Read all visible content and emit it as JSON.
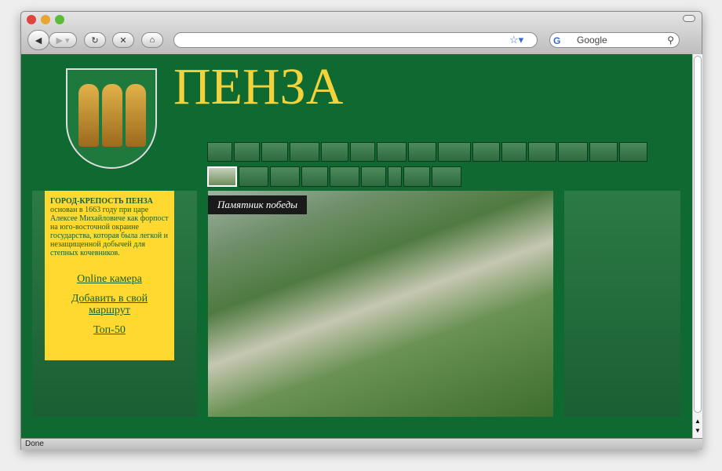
{
  "browser": {
    "url": "",
    "search_placeholder": "Google",
    "status": "Done",
    "icons": [
      "back-icon",
      "forward-icon",
      "reload-icon",
      "stop-icon",
      "home-icon",
      "star-icon",
      "search-icon"
    ]
  },
  "site": {
    "title": "ПЕНЗА",
    "info_heading": "ГОРОД-КРЕПОСТЬ ПЕНЗА",
    "info_text": "основан в 1663 году при царе Алексее Михайловиче как форпост на юго-восточной окраине государства, которая была легкой и незащищенной добычей для степных кочевников.",
    "links": [
      "Online камера",
      "Добавить в свой маршрут",
      "Топ-50"
    ],
    "photo_caption": "Памятник победы",
    "colors": {
      "background": "#0f6a32",
      "accent": "#ffd930",
      "title": "#f4d23a"
    }
  }
}
